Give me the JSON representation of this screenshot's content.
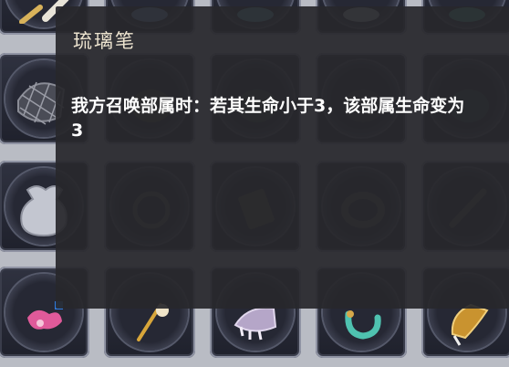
{
  "tooltip": {
    "title": "琉璃笔",
    "description": "我方召唤部属时：若其生命小于3，该部属生命变为3"
  },
  "inventory": {
    "items": [
      "brush-icon",
      "orb-icon",
      "flask-icon",
      "bell-icon",
      "fan-icon",
      "net-bag-icon",
      "pouch-icon",
      "pouch-icon",
      "pouch-icon",
      "pouch-icon",
      "sack-icon",
      "disc-icon",
      "scroll-icon",
      "ring-icon",
      "flute-icon",
      "flower-icon",
      "wand-icon",
      "claw-icon",
      "bracelet-icon",
      "horn-icon"
    ]
  },
  "colors": {
    "tooltip_bg": "#28282c",
    "title": "#ece3cf",
    "text": "#ffffff"
  }
}
